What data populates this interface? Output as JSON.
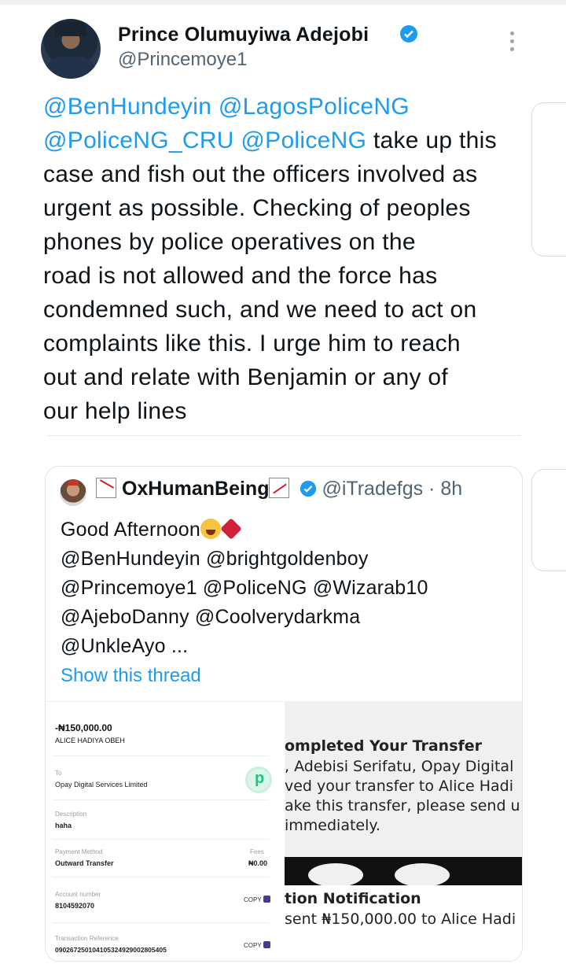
{
  "tweet": {
    "author_name": "Prince Olumuyiwa Adejobi",
    "author_handle": "@Princemoye1",
    "lines": [
      [
        {
          "t": "@BenHundeyin @LagosPoliceNG",
          "m": true
        }
      ],
      [
        {
          "t": "@PoliceNG_CRU @PoliceNG",
          "m": true
        },
        {
          "t": " take up this",
          "m": false
        }
      ],
      [
        {
          "t": "case and fish out the officers involved as",
          "m": false
        }
      ],
      [
        {
          "t": "urgent as possible. Checking of peoples",
          "m": false
        }
      ],
      [
        {
          "t": "phones by police operatives on the",
          "m": false
        }
      ],
      [
        {
          "t": "road is not allowed and the force has",
          "m": false
        }
      ],
      [
        {
          "t": "condemned such, and we need to act on",
          "m": false
        }
      ],
      [
        {
          "t": "complaints like this. I urge him to reach",
          "m": false
        }
      ],
      [
        {
          "t": "out and relate with Benjamin or any of",
          "m": false
        }
      ],
      [
        {
          "t": "our help lines",
          "m": false
        }
      ]
    ]
  },
  "quote": {
    "display_name": "OxHumanBeing",
    "handle_time": "@iTradefgs · 8h",
    "greeting": "Good Afternoon",
    "mention_lines": [
      " @BenHundeyin @brightgoldenboy",
      "@Princemoye1 @PoliceNG @Wizarab10",
      "@AjeboDanny @Coolverydarkma",
      "@UnkleAyo ..."
    ],
    "show_thread": "Show this thread"
  },
  "receipt": {
    "amount": "-₦150,000.00",
    "payee": "ALICE HADIYA OBEH",
    "to_label": "To",
    "to_value": "Opay Digital Services Limited",
    "desc_label": "Description",
    "desc_value": "haha",
    "method_label": "Payment Method",
    "method_value": "Outward Transfer",
    "fees_label": "Fees",
    "fees_value": "₦0.00",
    "account_label": "Account number",
    "account_value": "8104592070",
    "ref_label": "Transaction Reference",
    "ref_value": "090267250104105324929002805405",
    "copy_label": "COPY"
  },
  "notice": {
    "lines": [
      "ompleted Your Transfer",
      ", Adebisi Serifatu, Opay Digital",
      "ved your transfer to Alice Hadi",
      "ake this transfer, please send u",
      " immediately."
    ],
    "title2": "tion Notification",
    "line6": "sent ₦150,000.00 to Alice Hadi"
  },
  "colors": {
    "mention": "#1d9bf0",
    "verified": "#1d9bf0",
    "muted": "#536471"
  },
  "icons": [
    "verified-badge-icon",
    "more-options-icon",
    "chart-decreasing-icon",
    "chart-increasing-icon",
    "crying-face-icon",
    "broken-heart-icon",
    "opay-logo-icon",
    "copy-icon"
  ]
}
